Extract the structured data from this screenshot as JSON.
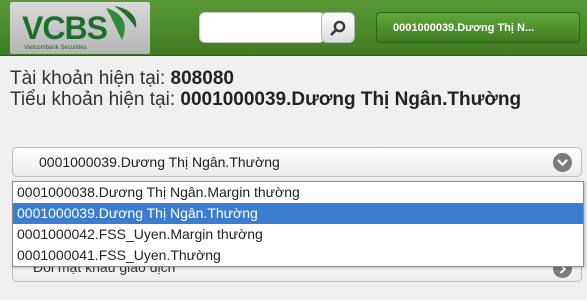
{
  "header": {
    "logo_text": "VCBS",
    "logo_subtext": "Vietcombank Securities",
    "search_placeholder": "",
    "search_icon": "search-icon",
    "account_button_label": "0001000039.Dương Thị N..."
  },
  "info": {
    "current_account_label": "Tài khoản hiện tại:",
    "current_account_value": "808080",
    "current_subaccount_label": "Tiểu khoản hiện tại:",
    "current_subaccount_value": "0001000039.Dương Thị Ngân.Thường"
  },
  "select": {
    "selected_value": "0001000039.Dương Thị Ngân.Thường",
    "icon": "chevron-down-icon"
  },
  "dropdown": {
    "options": [
      {
        "label": "0001000038.Dương Thị Ngân.Margin thường",
        "selected": false
      },
      {
        "label": "0001000039.Dương Thị Ngân.Thường",
        "selected": true
      },
      {
        "label": "0001000042.FSS_Uyen.Margin thường",
        "selected": false
      },
      {
        "label": "0001000041.FSS_Uyen.Thường",
        "selected": false
      }
    ]
  },
  "underlying_row": {
    "label": "Đổi mật khẩu giao dịch"
  },
  "colors": {
    "header_green": "#4a8a2c",
    "selection_blue": "#3b7ed0"
  }
}
